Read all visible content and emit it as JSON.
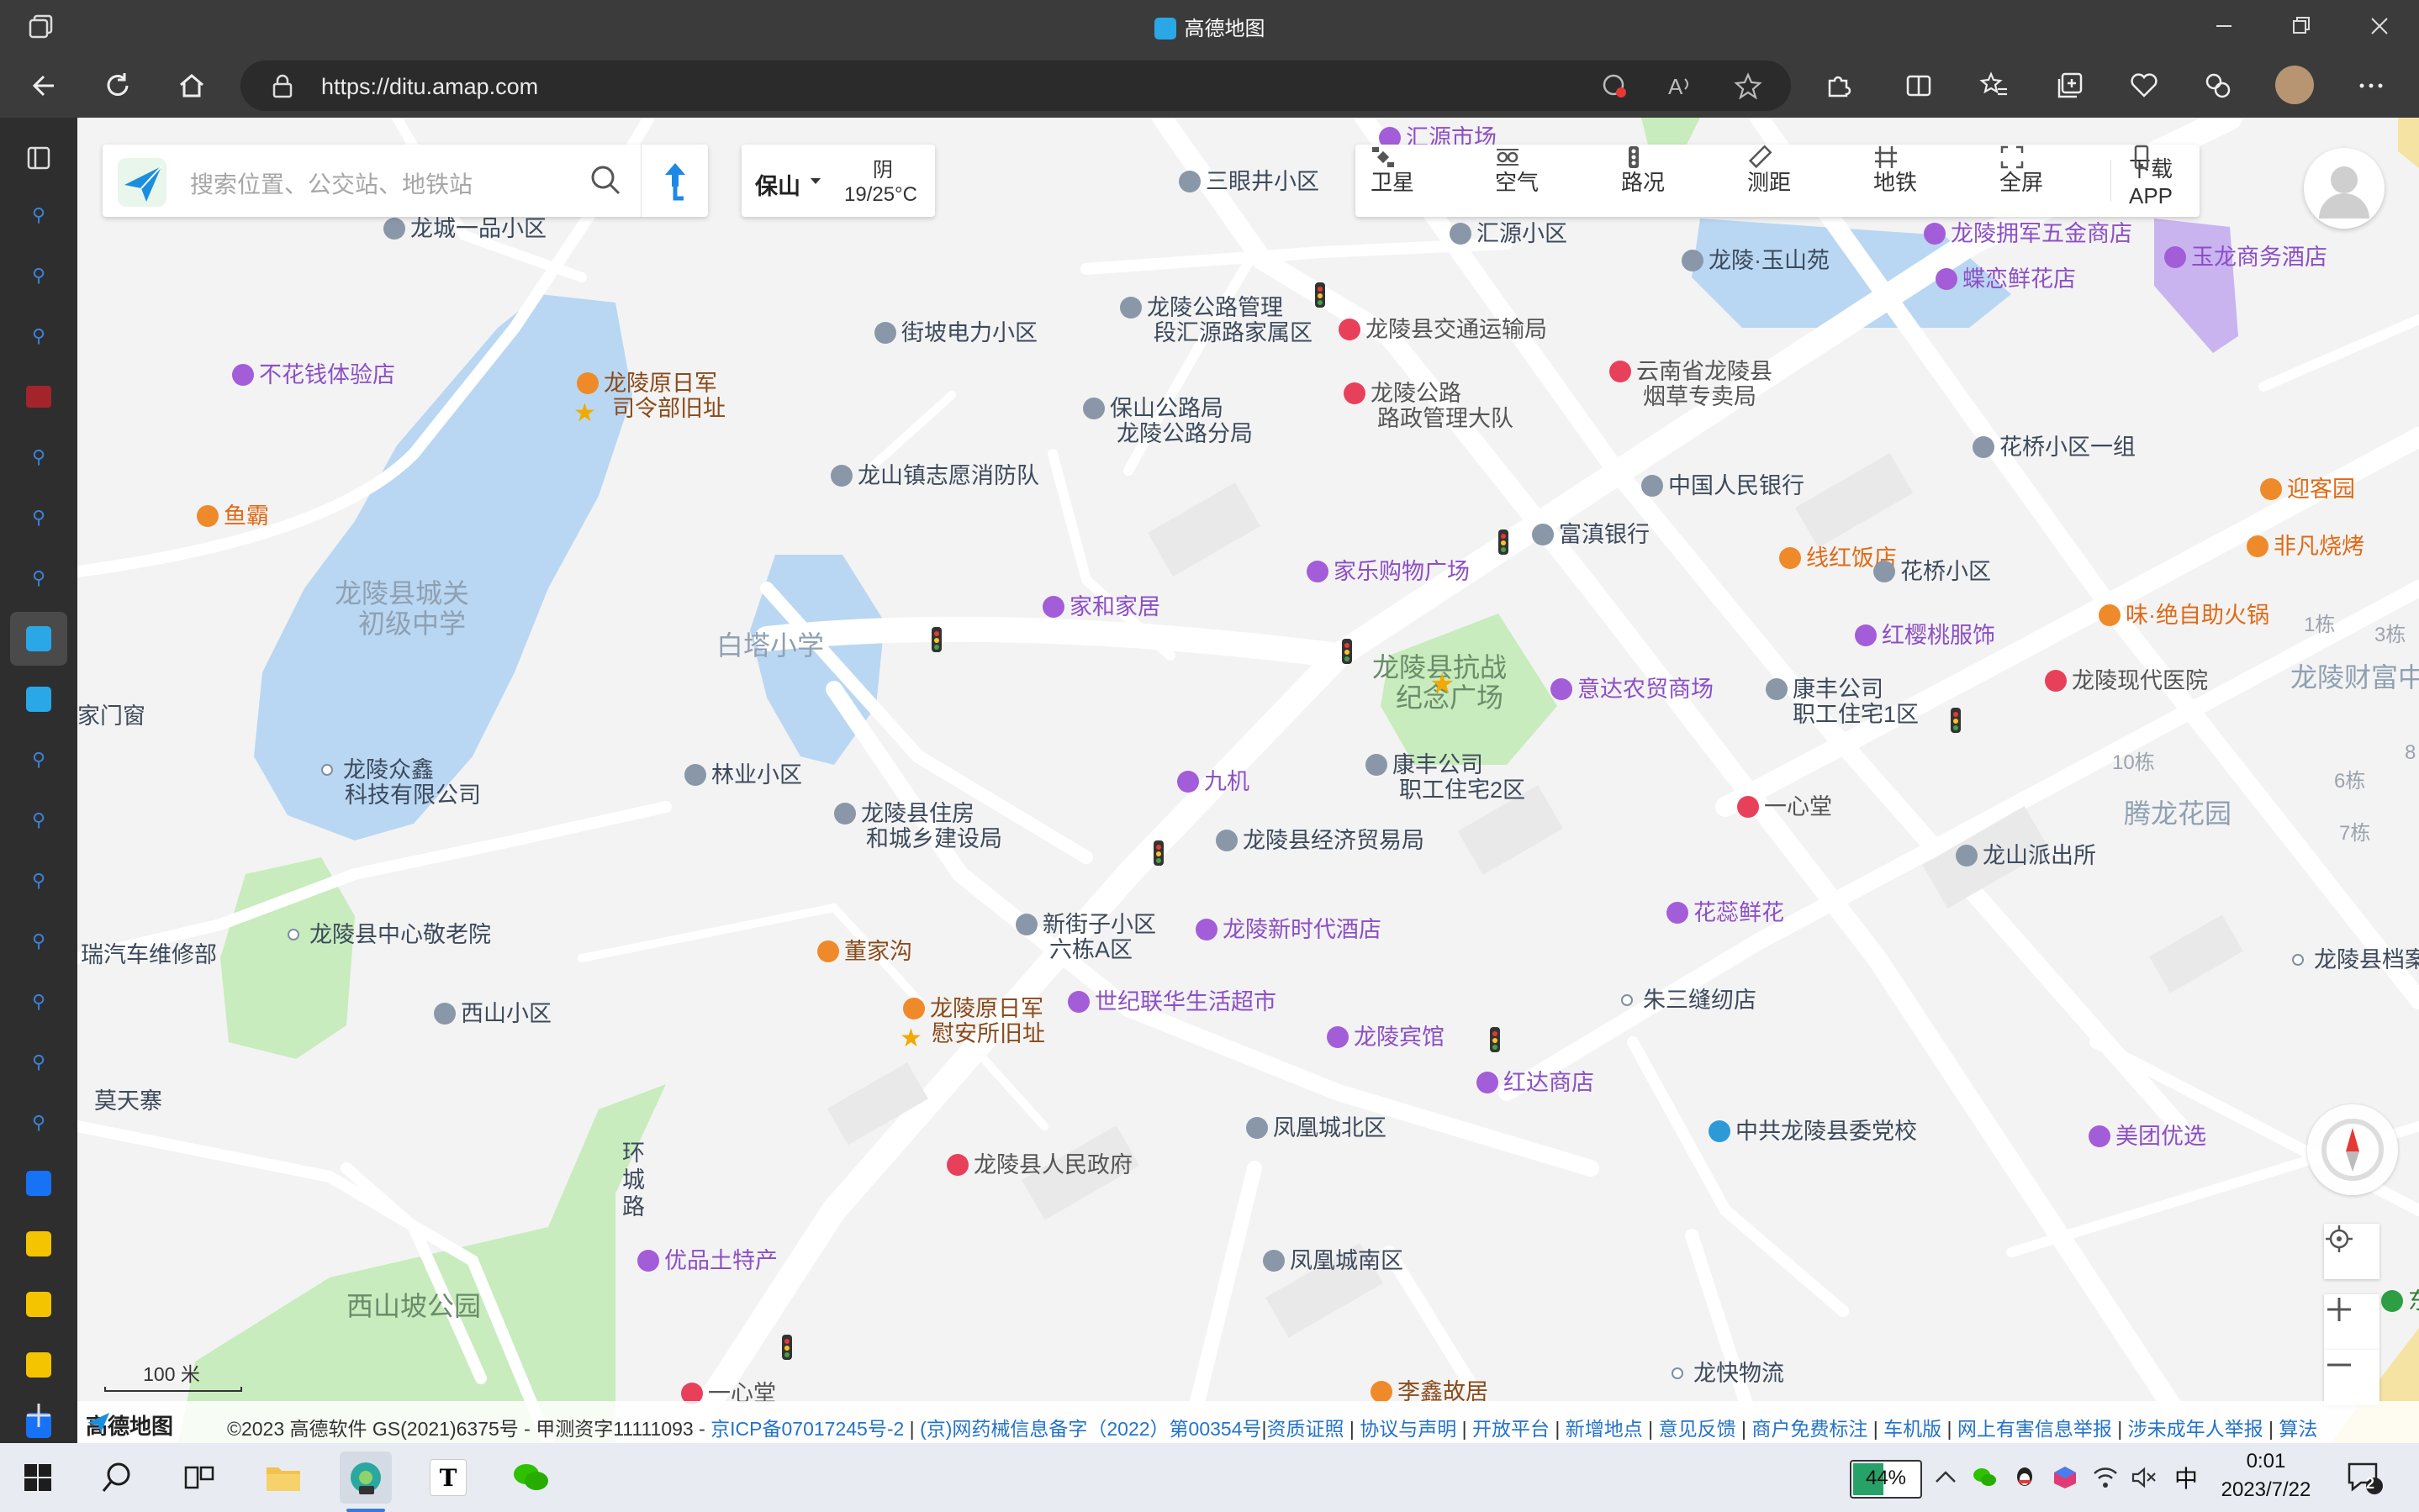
{
  "browser": {
    "window_title": "高德地图",
    "url": "https://ditu.amap.com"
  },
  "search": {
    "placeholder": "搜索位置、公交站、地铁站"
  },
  "weather": {
    "city": "保山",
    "condition": "阴",
    "temperature": "19/25°C"
  },
  "toolbar": {
    "items": [
      "卫星",
      "空气",
      "路况",
      "测距",
      "地铁",
      "全屏"
    ],
    "download": "下载APP"
  },
  "map": {
    "labels": {
      "l0": "三眼井小区",
      "l1": "汇源小区",
      "l2": "龙陵·玉山苑",
      "l3": "龙陵拥军五金商店",
      "l4": "玉龙商务酒店",
      "l5": "蝶恋鲜花店",
      "l6": "龙城一品小区",
      "l7": "街坡电力小区",
      "l8": "龙陵公路管理",
      "l9": "段汇源路家属区",
      "l10": "龙陵县交通运输局",
      "l11": "云南省龙陵县",
      "l12": "烟草专卖局",
      "l13": "不花钱体验店",
      "l14": "龙陵原日军",
      "l15": "司令部旧址",
      "l16": "保山公路局",
      "l17": "龙陵公路分局",
      "l18": "龙陵公路",
      "l19": "路政管理大队",
      "l20": "花桥小区一组",
      "l21": "迎客园",
      "l22": "龙山镇志愿消防队",
      "l23": "中国人民银行",
      "l24": "鱼霸",
      "l25": "富滇银行",
      "l26": "线红饭店",
      "l27": "非凡烧烤",
      "l28": "家乐购物广场",
      "l29": "花桥小区",
      "l30": "家和家居",
      "l31": "味·绝自助火锅",
      "l32": "红樱桃服饰",
      "l33": "1栋",
      "l34": "3栋",
      "l35": "龙陵现代医院",
      "l36": "意达农贸商场",
      "l37": "康丰公司",
      "l38": "职工住宅1区",
      "l39": "家门窗",
      "l40": "林业小区",
      "l41": "九机",
      "l42": "康丰公司",
      "l43": "职工住宅2区",
      "l44": "10栋",
      "l45": "6栋",
      "l46": "龙陵众鑫",
      "l47": "科技有限公司",
      "l48": "龙陵县住房",
      "l49": "和城乡建设局",
      "l50": "龙陵县经济贸易局",
      "l51": "一心堂",
      "l52": "7栋",
      "l53": "龙山派出所",
      "l54": "龙陵县中心敬老院",
      "l55": "瑞汽车维修部",
      "l56": "新街子小区",
      "l57": "六栋A区",
      "l58": "龙陵新时代酒店",
      "l59": "花蕊鲜花",
      "l60": "董家沟",
      "l61": "龙陵县档案",
      "l62": "龙陵原日军",
      "l63": "慰安所旧址",
      "l64": "世纪联华生活超市",
      "l65": "朱三缝纫店",
      "l66": "西山小区",
      "l67": "龙陵宾馆",
      "l68": "红达商店",
      "l69": "莫天寨",
      "l70": "凤凰城北区",
      "l71": "中共龙陵县委党校",
      "l72": "美团优选",
      "l73": "环",
      "l74": "城",
      "l75": "路",
      "l76": "龙陵县人民政府",
      "l77": "优品土特产",
      "l78": "凤凰城南区",
      "l79": "东环",
      "l80": "龙快物流",
      "l81": "一心堂",
      "l82": "李鑫故居",
      "l83": "8",
      "l84": "汇源市场"
    },
    "areas": {
      "a0": "龙陵县城关",
      "a1": "初级中学",
      "a2": "白塔小学",
      "a3": "龙陵县抗战",
      "a4": "纪念广场",
      "a5": "腾龙花园",
      "a6": "龙陵财富中",
      "a7": "西山坡公园"
    },
    "scale": "100 米"
  },
  "footer": {
    "logo": "高德地图",
    "copyright": "©2023 高德软件 GS(2021)6375号 - 甲测资字11111093 - ",
    "links": [
      "京ICP备07017245号-2",
      "(京)网药械信息备字（2022）第00354号",
      "资质证照",
      "协议与声明",
      "开放平台",
      "新增地点",
      "意见反馈",
      "商户免费标注",
      "车机版",
      "网上有害信息举报",
      "涉未成年人举报",
      "算法"
    ]
  },
  "taskbar": {
    "battery": "44%",
    "ime": "中",
    "time": "0:01",
    "date": "2023/7/22",
    "notifications": "2",
    "app_T": "T"
  },
  "colors": {
    "water": "#b9d7f2",
    "park": "#c8ecbd",
    "road": "#ffffff",
    "accent": "#2473c9"
  }
}
